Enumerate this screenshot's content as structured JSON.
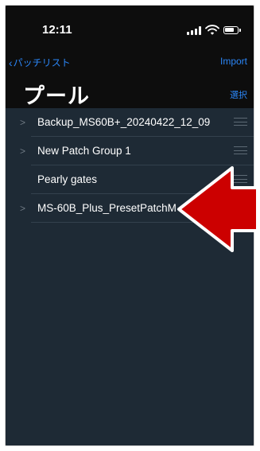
{
  "status_bar": {
    "time": "12:11"
  },
  "nav": {
    "back_label": "パッチリスト",
    "import_label": "Import"
  },
  "header": {
    "title": "プール",
    "select_label": "選択"
  },
  "list": {
    "items": [
      {
        "label": "Backup_MS60B+_20240422_12_09",
        "has_chevron": true
      },
      {
        "label": "New Patch Group 1",
        "has_chevron": true
      },
      {
        "label": "Pearly gates",
        "has_chevron": false
      },
      {
        "label": "MS-60B_Plus_PresetPatchM",
        "has_chevron": true
      }
    ]
  },
  "annotation": {
    "arrow_color": "#cc0000",
    "arrow_outline": "#ffffff"
  },
  "colors": {
    "accent": "#2b86f7",
    "background": "#0d0d0d",
    "list_background": "#1e2a35"
  }
}
